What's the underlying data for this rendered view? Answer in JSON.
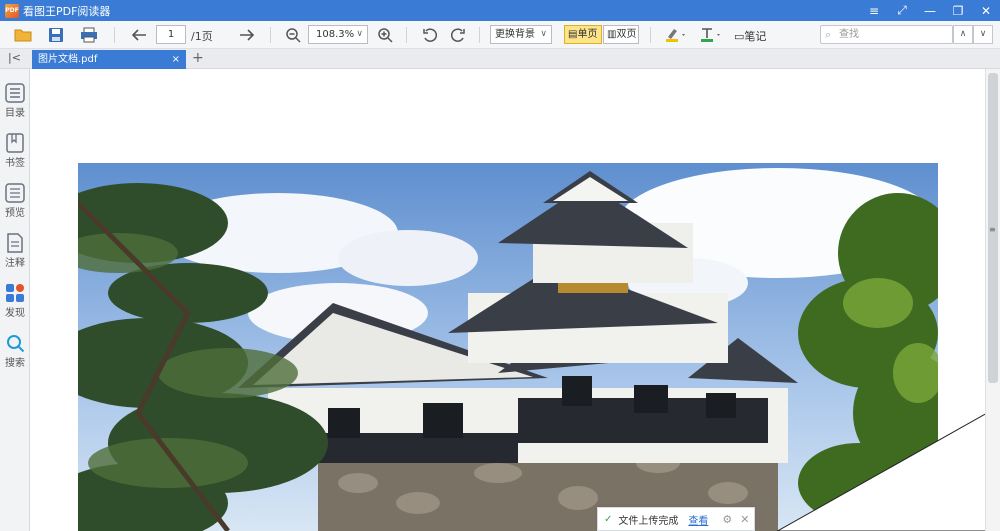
{
  "app": {
    "title": "看图王PDF阅读器",
    "logo_text": "PDF"
  },
  "window_controls": {
    "menu": "≡",
    "fullscreen": "⤢",
    "minimize": "—",
    "restore": "❐",
    "close": "✕"
  },
  "toolbar": {
    "page_current": "1",
    "page_total": "/1页",
    "zoom": "108.3%",
    "background_label": "更换背景",
    "single_page_label": "单页",
    "double_page_label": "双页",
    "note_label": "笔记",
    "search_placeholder": "查找",
    "highlight_color": "#f2c200",
    "text_color": "#2eaa4a"
  },
  "tabs": {
    "active": "图片文档.pdf",
    "close": "×",
    "add": "+"
  },
  "sidebar": {
    "items": [
      {
        "label": "目录",
        "icon": "toc-icon"
      },
      {
        "label": "书签",
        "icon": "bookmark-icon"
      },
      {
        "label": "预览",
        "icon": "preview-icon"
      },
      {
        "label": "注释",
        "icon": "annotation-icon"
      },
      {
        "label": "发现",
        "icon": "discover-icon"
      },
      {
        "label": "搜索",
        "icon": "search-icon"
      }
    ]
  },
  "toast": {
    "message": "文件上传完成",
    "link": "查看"
  },
  "colors": {
    "titlebar": "#3a7bd5",
    "active_tab": "#3a7bd5",
    "single_page_active": "#fce48a"
  }
}
